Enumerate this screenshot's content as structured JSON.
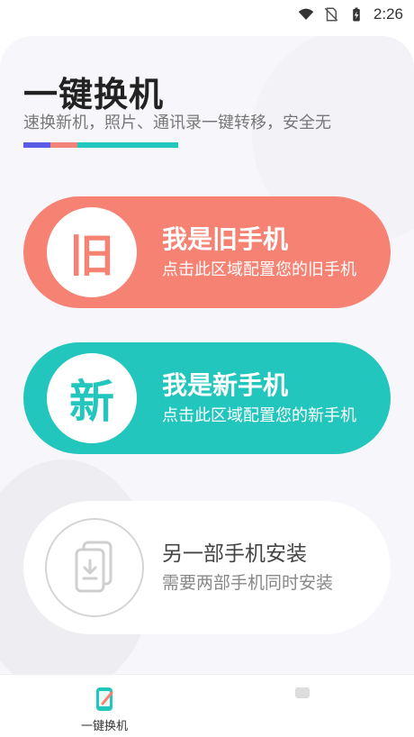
{
  "status_bar": {
    "time": "2:26",
    "icons": [
      "wifi-icon",
      "no-sim-icon",
      "battery-charging-icon"
    ]
  },
  "header": {
    "title": "一键换机",
    "subtitle": "速换新机，照片、通讯录一键转移，安全无",
    "underline_colors": [
      "#5b5be6",
      "#f2827a",
      "#22c8bd"
    ]
  },
  "cards": {
    "old_phone": {
      "badge": "旧",
      "title": "我是旧手机",
      "description": "点击此区域配置您的旧手机",
      "color": "#f58272"
    },
    "new_phone": {
      "badge": "新",
      "title": "我是新手机",
      "description": "点击此区域配置您的新手机",
      "color": "#22c6bd"
    },
    "install": {
      "icon": "phone-download-icon",
      "title": "另一部手机安装",
      "description": "需要两部手机同时安装"
    }
  },
  "bottom_nav": {
    "items": [
      {
        "label": "一键换机",
        "icon": "phone-transfer-icon",
        "active": true
      }
    ]
  }
}
